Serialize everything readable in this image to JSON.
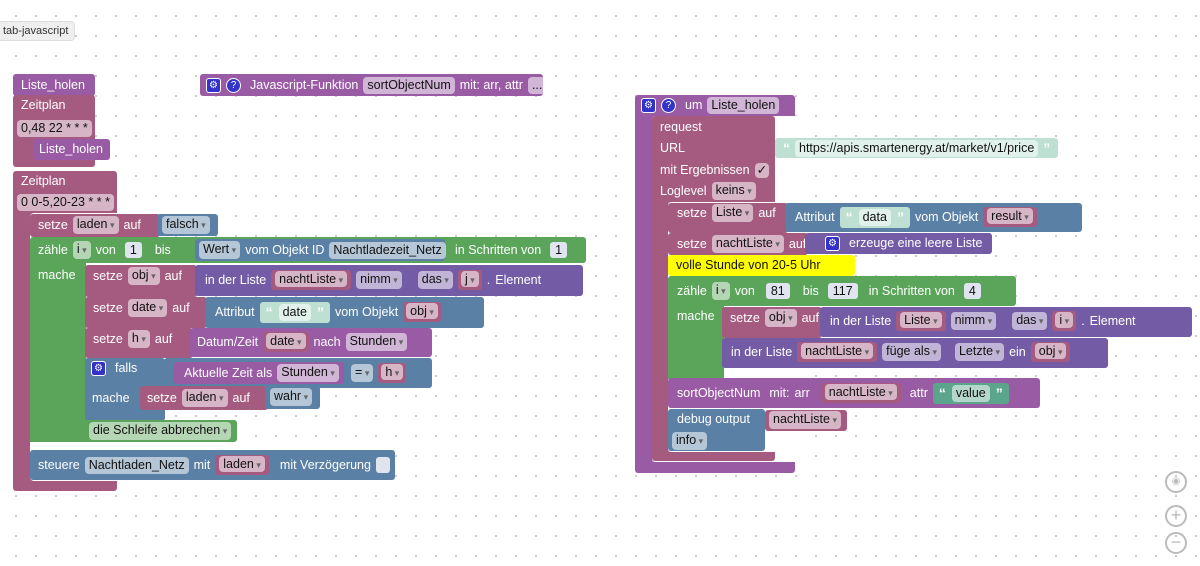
{
  "tab_label": "tab-javascript",
  "colors": {
    "procedure": "#9a5ba5",
    "system": "#a55b80",
    "loop": "#5ba55b",
    "logic": "#5b80a5",
    "list": "#745ba5",
    "text": "#bde0d3",
    "comment": "#ffff00"
  },
  "left": {
    "hat": "Liste_holen",
    "schedule1": {
      "label": "Zeitplan",
      "cron": "0,48 22 * * *",
      "call": "Liste_holen"
    },
    "schedule2": {
      "label": "Zeitplan",
      "cron": "0 0-5,20-23 * * *"
    },
    "set_laden": {
      "setze": "setze",
      "var": "laden",
      "auf": "auf",
      "value": "falsch"
    },
    "loop": {
      "zaehle": "zähle",
      "var": "i",
      "von": "von",
      "from": "1",
      "bis": "bis",
      "wert": "Wert",
      "vom_objekt_id": "vom Objekt ID",
      "object_id": "Nachtladezeit_Netz",
      "step_label": "in Schritten von",
      "step": "1",
      "mache": "mache"
    },
    "set_obj": {
      "setze": "setze",
      "var": "obj",
      "auf": "auf",
      "in_der_liste": "in der Liste",
      "list": "nachtListe",
      "op": "nimm",
      "mode": "das",
      "index": "j",
      "dot": ".",
      "element": "Element"
    },
    "set_date": {
      "setze": "setze",
      "var": "date",
      "auf": "auf",
      "attribut": "Attribut",
      "q_open": "“",
      "attr": "date",
      "q_close": "”",
      "vom_objekt": "vom Objekt",
      "obj": "obj"
    },
    "set_h": {
      "setze": "setze",
      "var": "h",
      "auf": "auf",
      "datum_zeit": "Datum/Zeit",
      "date": "date",
      "nach": "nach",
      "unit": "Stunden"
    },
    "if": {
      "falls": "falls",
      "aktuelle_zeit": "Aktuelle Zeit als",
      "unit": "Stunden",
      "op": "=",
      "var": "h",
      "mache": "mache",
      "setze": "setze",
      "set_var": "laden",
      "auf": "auf",
      "value": "wahr"
    },
    "break": "die Schleife abbrechen",
    "control": {
      "steuere": "steuere",
      "object": "Nachtladen_Netz",
      "mit": "mit",
      "var": "laden",
      "delay": "mit Verzögerung",
      "delay_checked": false
    }
  },
  "js_function": {
    "help": "?",
    "label": "Javascript-Funktion",
    "name": "sortObjectNum",
    "params": "mit: arr, attr",
    "more": "..."
  },
  "right": {
    "hat": {
      "help": "?",
      "um": "um",
      "name": "Liste_holen"
    },
    "request": {
      "label": "request",
      "url_label": "URL",
      "q_open": "“",
      "url": "https://apis.smartenergy.at/market/v1/price",
      "q_close": "”",
      "results_label": "mit Ergebnissen",
      "results_checked": "✓",
      "loglevel_label": "Loglevel",
      "loglevel": "keins"
    },
    "set_liste": {
      "setze": "setze",
      "var": "Liste",
      "auf": "auf",
      "attribut": "Attribut",
      "q_open": "“",
      "attr": "data",
      "q_close": "”",
      "vom_objekt": "vom Objekt",
      "obj": "result"
    },
    "set_nacht": {
      "setze": "setze",
      "var": "nachtListe",
      "auf": "auf",
      "create": "erzeuge eine leere Liste"
    },
    "comment": "volle Stunde von 20-5 Uhr",
    "loop": {
      "zaehle": "zähle",
      "var": "i",
      "von": "von",
      "from": "81",
      "bis": "bis",
      "to": "117",
      "step_label": "in Schritten von",
      "step": "4",
      "mache": "mache"
    },
    "set_obj": {
      "setze": "setze",
      "var": "obj",
      "auf": "auf",
      "in_der_liste": "in der Liste",
      "list": "Liste",
      "op": "nimm",
      "mode": "das",
      "index": "i",
      "dot": ".",
      "element": "Element"
    },
    "append": {
      "in_der_liste": "in der Liste",
      "list": "nachtListe",
      "op": "füge als",
      "pos": "Letzte",
      "ein": "ein",
      "item": "obj"
    },
    "sort": {
      "name": "sortObjectNum",
      "mit": "mit:",
      "arr": "arr",
      "list": "nachtListe",
      "attr": "attr",
      "q_open": "“",
      "value": "value",
      "q_close": "”"
    },
    "debug": {
      "label": "debug output",
      "var": "nachtListe",
      "level": "info"
    }
  }
}
